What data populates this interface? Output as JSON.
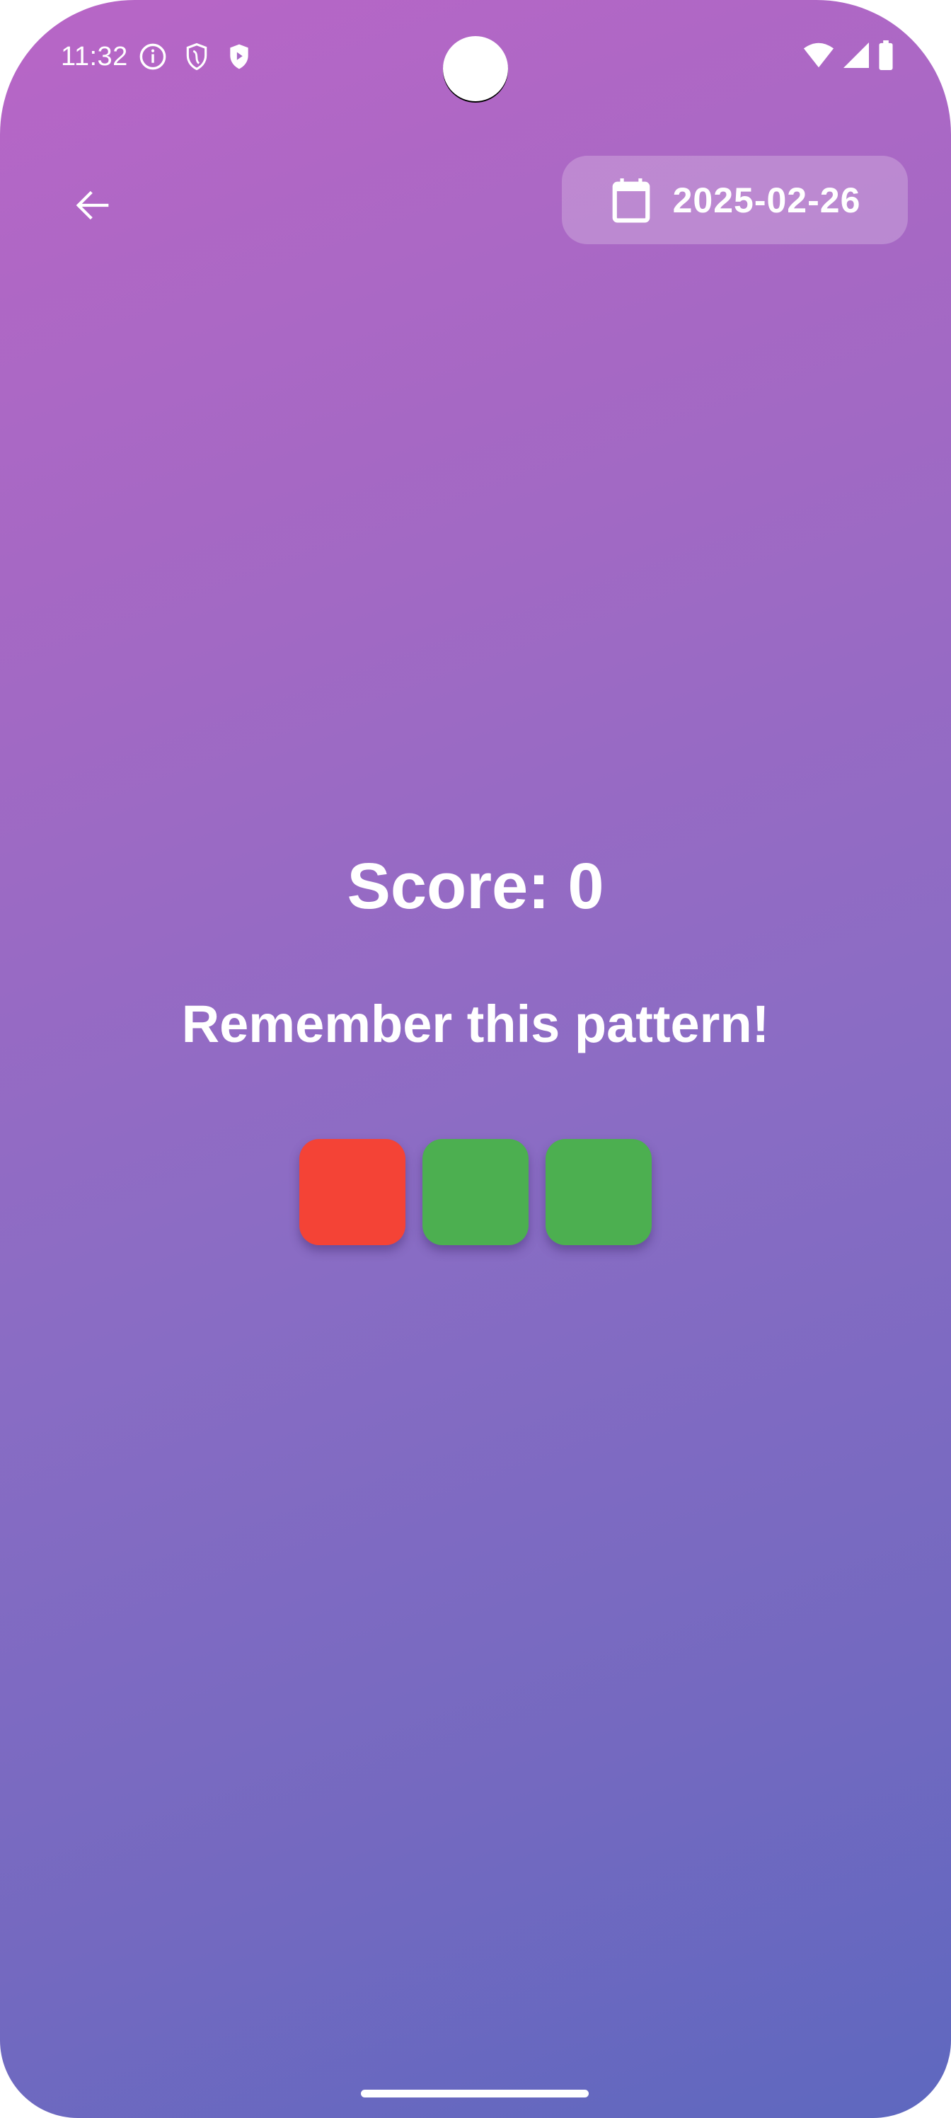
{
  "status_bar": {
    "time": "11:32",
    "icons_left": [
      "info-icon",
      "shield-icon",
      "play-shield-icon"
    ],
    "icons_right": [
      "wifi-icon",
      "signal-icon",
      "battery-icon"
    ]
  },
  "header": {
    "back_icon": "arrow-left-icon",
    "date": "2025-02-26",
    "date_icon": "calendar-icon"
  },
  "game": {
    "score_text": "Score: 0",
    "prompt": "Remember this pattern!",
    "pattern": [
      {
        "color": "#f44336"
      },
      {
        "color": "#4caf50"
      },
      {
        "color": "#4caf50"
      }
    ]
  },
  "colors": {
    "gradient_start": "#b866c6",
    "gradient_end": "#5e68bf",
    "red": "#f44336",
    "green": "#4caf50"
  }
}
